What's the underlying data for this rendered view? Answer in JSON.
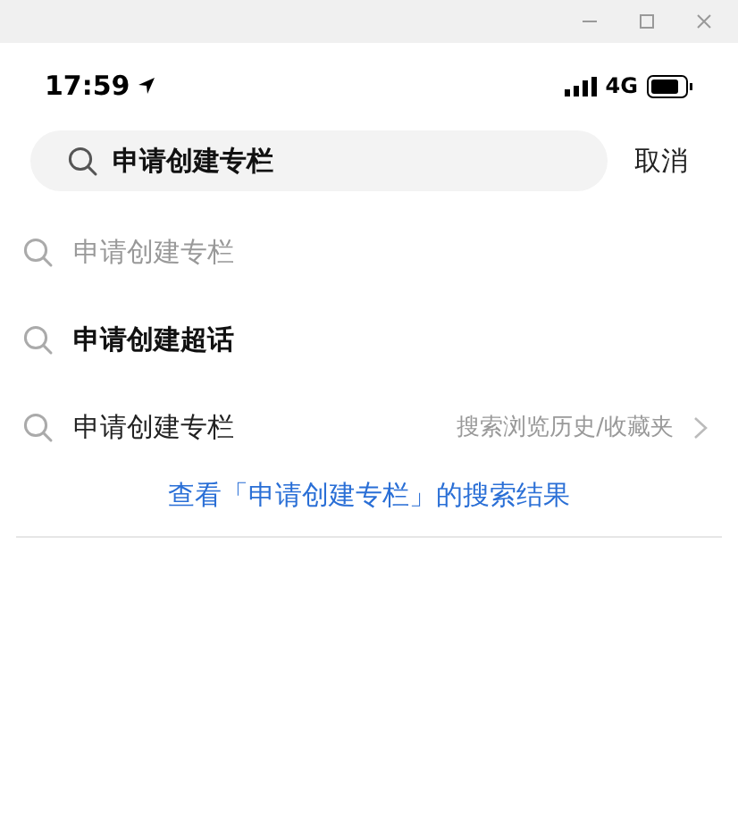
{
  "status_bar": {
    "time": "17:59",
    "network": "4G"
  },
  "search": {
    "value": "申请创建专栏",
    "cancel": "取消"
  },
  "suggestions": [
    {
      "kind": "muted",
      "text": "申请创建专栏"
    },
    {
      "kind": "bold",
      "text": "申请创建超话"
    },
    {
      "kind": "normal",
      "text": "申请创建专栏",
      "hint": "搜索浏览历史/收藏夹"
    }
  ],
  "results_link": "查看「申请创建专栏」的搜索结果"
}
